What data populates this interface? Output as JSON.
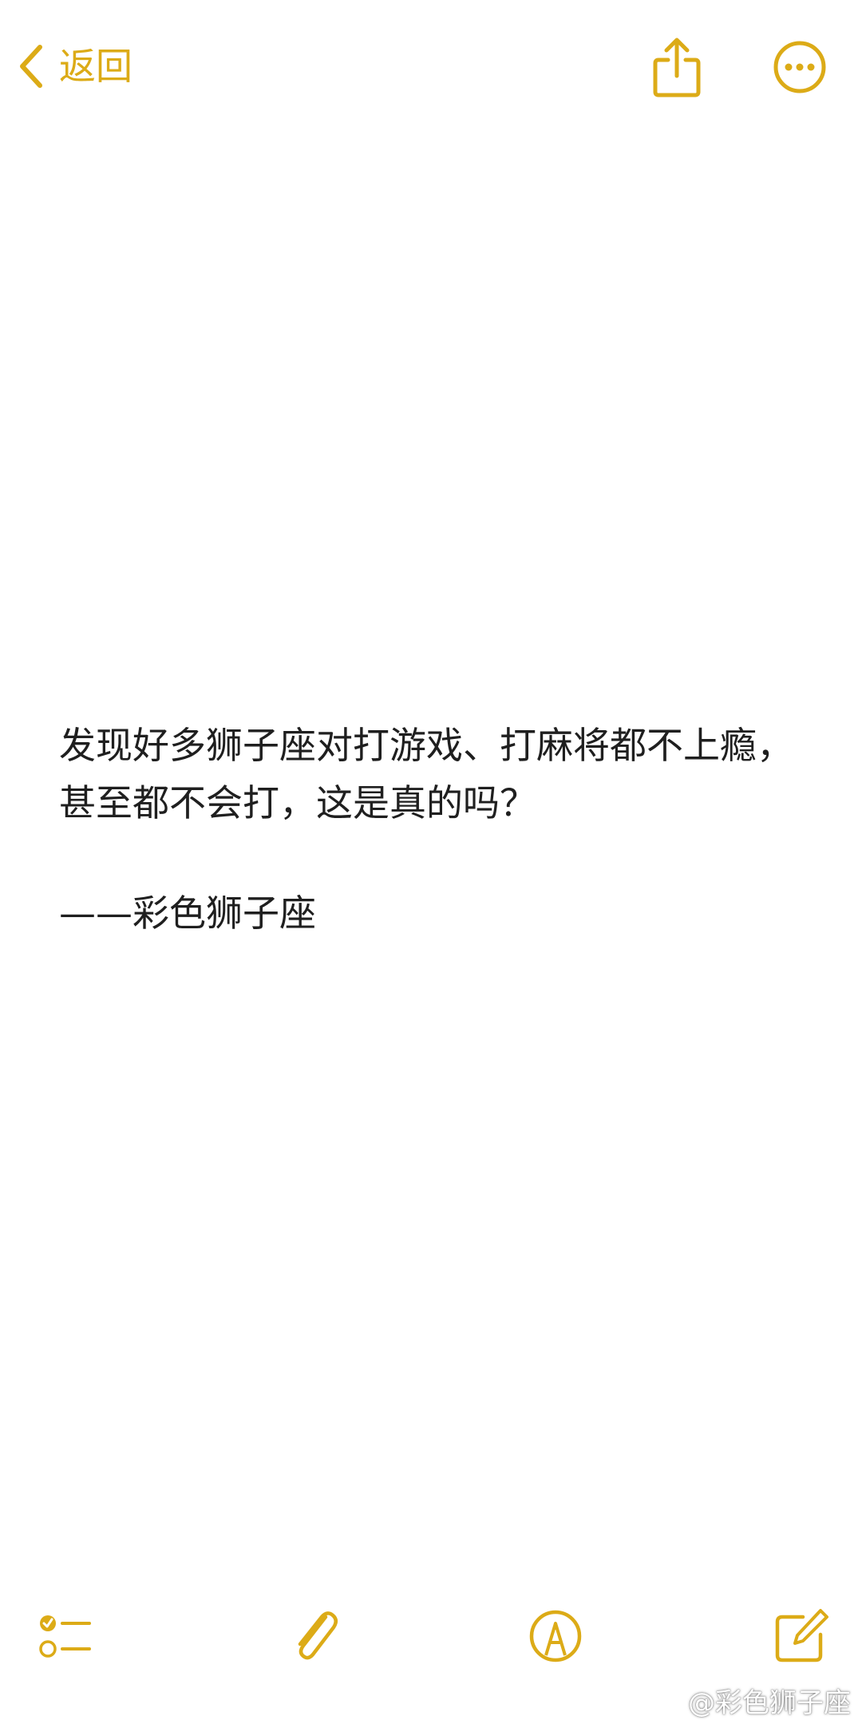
{
  "topbar": {
    "back_label": "返回",
    "back_icon": "chevron-left-icon",
    "share_icon": "share-icon",
    "more_icon": "ellipsis-circle-icon"
  },
  "note": {
    "lines": [
      "发现好多狮子座对打游戏、打麻将都不上瘾，",
      "甚至都不会打，这是真的吗？"
    ],
    "signature": "——彩色狮子座"
  },
  "toolbar": {
    "items": [
      {
        "icon": "checklist-icon"
      },
      {
        "icon": "paperclip-icon"
      },
      {
        "icon": "markup-pen-icon"
      },
      {
        "icon": "compose-icon"
      }
    ]
  },
  "watermark": {
    "text": "@彩色狮子座",
    "icon": "weibo-logo-icon"
  },
  "colors": {
    "accent": "#dcab17",
    "text": "#1f1f1f",
    "background": "#ffffff"
  }
}
